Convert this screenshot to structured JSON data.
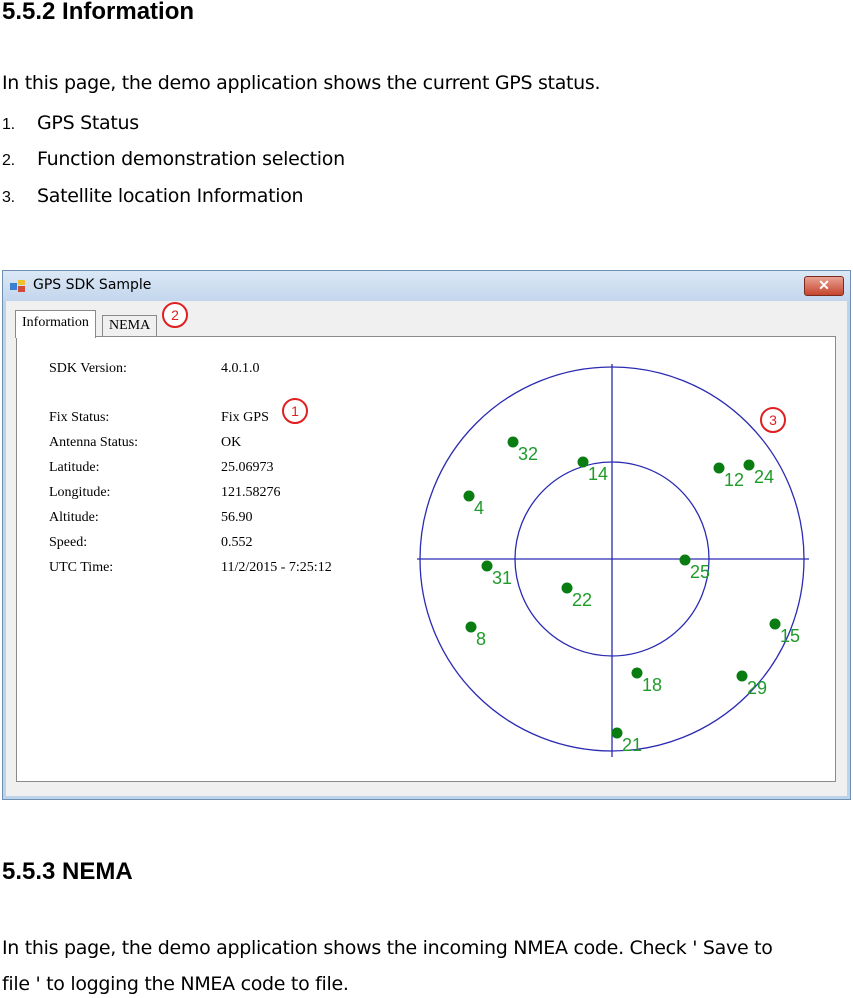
{
  "section1": {
    "heading": "5.5.2 Information",
    "intro": "In this page, the demo application shows the current GPS status.",
    "list": [
      {
        "num": "1.",
        "text": "GPS Status"
      },
      {
        "num": "2.",
        "text": "Function demonstration selection"
      },
      {
        "num": "3.",
        "text": "Satellite location Information"
      }
    ]
  },
  "window": {
    "title": "GPS SDK Sample",
    "close_glyph": "✕",
    "tabs": [
      "Information",
      "NEMA"
    ],
    "fields": [
      {
        "label": "SDK Version:",
        "value": "4.0.1.0"
      },
      {
        "label": "Fix Status:",
        "value": "Fix GPS"
      },
      {
        "label": "Antenna Status:",
        "value": "OK"
      },
      {
        "label": "Latitude:",
        "value": "25.06973"
      },
      {
        "label": "Longitude:",
        "value": "121.58276"
      },
      {
        "label": "Altitude:",
        "value": "56.90"
      },
      {
        "label": "Speed:",
        "value": "0.552"
      },
      {
        "label": "UTC Time:",
        "value": "11/2/2015 - 7:25:12"
      }
    ],
    "callouts": [
      "1",
      "2",
      "3"
    ],
    "satellites": [
      "32",
      "14",
      "12",
      "24",
      "4",
      "31",
      "22",
      "25",
      "8",
      "15",
      "18",
      "29",
      "21"
    ],
    "colors": {
      "satellite": "#0a7d12",
      "satellite_label": "#1f9b2a",
      "sky_lines": "#2b2bb3",
      "callout": "#e02020"
    }
  },
  "section2": {
    "heading": "5.5.3 NEMA",
    "body_line1": "In this page, the demo application shows the incoming NMEA code. Check ' Save to",
    "body_line2": "file ' to logging the NMEA code to file."
  }
}
